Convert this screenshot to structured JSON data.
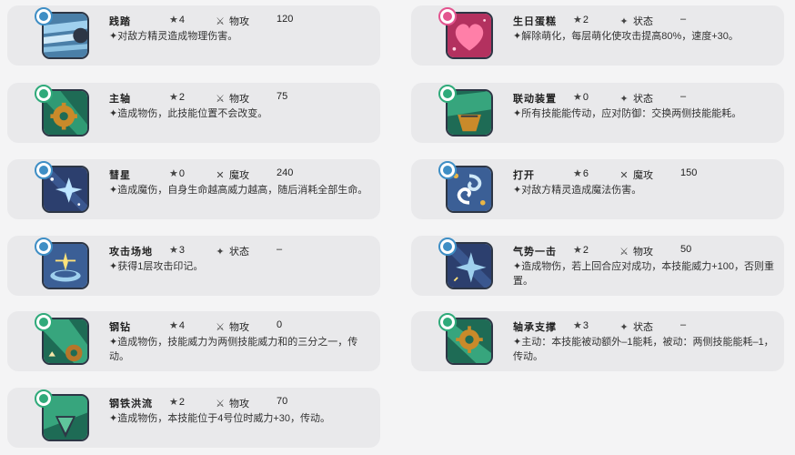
{
  "colors": {
    "background": "#f4f4f5",
    "card": "#e9e9eb",
    "badge_blue": "#3e8ec5",
    "badge_green": "#2faa7a",
    "badge_pink": "#e3548f"
  },
  "skills": [
    {
      "name": "践踏",
      "cost": "4",
      "type": "物攻",
      "type_icon": "sword-icon",
      "power": "120",
      "desc": "✦对敌方精灵造成物理伤害。",
      "badge": "blue"
    },
    {
      "name": "主轴",
      "cost": "2",
      "type": "物攻",
      "type_icon": "sword-icon",
      "power": "75",
      "desc": "✦造成物伤，此技能位置不会改变。",
      "badge": "green"
    },
    {
      "name": "彗星",
      "cost": "0",
      "type": "魔攻",
      "type_icon": "crossed-wands-icon",
      "power": "240",
      "desc": "✦造成魔伤，自身生命越高威力越高，随后消耗全部生命。",
      "badge": "blue"
    },
    {
      "name": "攻击场地",
      "cost": "3",
      "type": "状态",
      "type_icon": "sparkle-icon",
      "power": "–",
      "desc": "✦获得1层攻击印记。",
      "badge": "blue"
    },
    {
      "name": "钢钻",
      "cost": "4",
      "type": "物攻",
      "type_icon": "sword-icon",
      "power": "0",
      "desc": "✦造成物伤，技能威力为两侧技能威力和的三分之一，传动。",
      "badge": "green"
    },
    {
      "name": "钢铁洪流",
      "cost": "2",
      "type": "物攻",
      "type_icon": "sword-icon",
      "power": "70",
      "desc": "✦造成物伤，本技能位于4号位时威力+30，传动。",
      "badge": "green"
    },
    {
      "name": "生日蛋糕",
      "cost": "2",
      "type": "状态",
      "type_icon": "sparkle-icon",
      "power": "–",
      "desc": "✦解除萌化，每层萌化使攻击提高80%，速度+30。",
      "badge": "pink"
    },
    {
      "name": "联动装置",
      "cost": "0",
      "type": "状态",
      "type_icon": "sparkle-icon",
      "power": "–",
      "desc": "✦所有技能能传动，应对防御：交换两侧技能能耗。",
      "badge": "green"
    },
    {
      "name": "打开",
      "cost": "6",
      "type": "魔攻",
      "type_icon": "crossed-wands-icon",
      "power": "150",
      "desc": "✦对敌方精灵造成魔法伤害。",
      "badge": "blue"
    },
    {
      "name": "气势一击",
      "cost": "2",
      "type": "物攻",
      "type_icon": "sword-icon",
      "power": "50",
      "desc": "✦造成物伤，若上回合应对成功，本技能威力+100，否则重置。",
      "badge": "blue"
    },
    {
      "name": "轴承支撑",
      "cost": "3",
      "type": "状态",
      "type_icon": "sparkle-icon",
      "power": "–",
      "desc": "✦主动：本技能被动额外–1能耗，被动：两侧技能能耗–1，传动。",
      "badge": "green"
    }
  ]
}
